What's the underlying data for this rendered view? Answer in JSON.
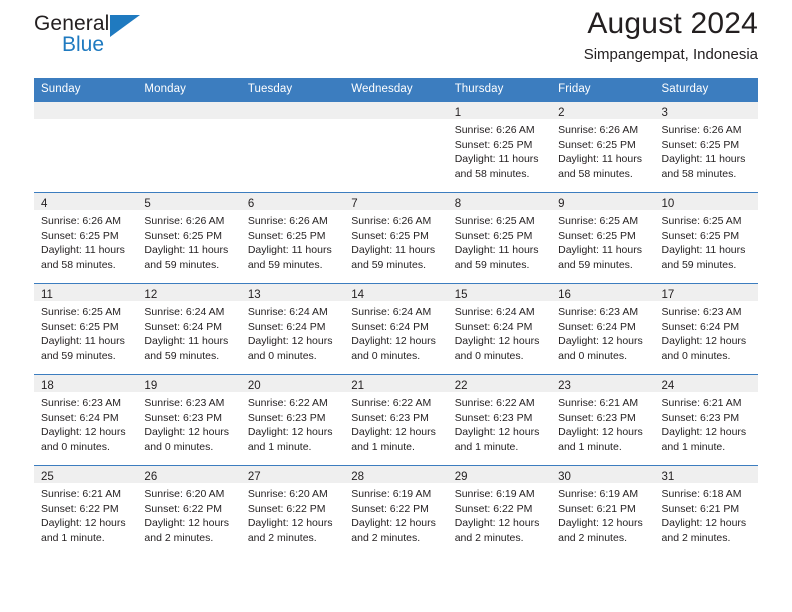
{
  "logo": {
    "word_top": "General",
    "word_bottom": "Blue",
    "triangle_color": "#1f7ac0"
  },
  "header": {
    "title": "August 2024",
    "subtitle": "Simpangempat, Indonesia"
  },
  "theme": {
    "header_blue": "#3c7dbf",
    "daystrip_gray": "#efefef",
    "text": "#231f20"
  },
  "weekday_headers": [
    "Sunday",
    "Monday",
    "Tuesday",
    "Wednesday",
    "Thursday",
    "Friday",
    "Saturday"
  ],
  "labels": {
    "sunrise_prefix": "Sunrise:",
    "sunset_prefix": "Sunset:",
    "daylight_prefix": "Daylight:"
  },
  "weeks": [
    [
      {
        "empty": true
      },
      {
        "empty": true
      },
      {
        "empty": true
      },
      {
        "empty": true
      },
      {
        "day": "1",
        "sunrise": "Sunrise: 6:26 AM",
        "sunset": "Sunset: 6:25 PM",
        "daylight_l1": "Daylight: 11 hours",
        "daylight_l2": "and 58 minutes."
      },
      {
        "day": "2",
        "sunrise": "Sunrise: 6:26 AM",
        "sunset": "Sunset: 6:25 PM",
        "daylight_l1": "Daylight: 11 hours",
        "daylight_l2": "and 58 minutes."
      },
      {
        "day": "3",
        "sunrise": "Sunrise: 6:26 AM",
        "sunset": "Sunset: 6:25 PM",
        "daylight_l1": "Daylight: 11 hours",
        "daylight_l2": "and 58 minutes."
      }
    ],
    [
      {
        "day": "4",
        "sunrise": "Sunrise: 6:26 AM",
        "sunset": "Sunset: 6:25 PM",
        "daylight_l1": "Daylight: 11 hours",
        "daylight_l2": "and 58 minutes."
      },
      {
        "day": "5",
        "sunrise": "Sunrise: 6:26 AM",
        "sunset": "Sunset: 6:25 PM",
        "daylight_l1": "Daylight: 11 hours",
        "daylight_l2": "and 59 minutes."
      },
      {
        "day": "6",
        "sunrise": "Sunrise: 6:26 AM",
        "sunset": "Sunset: 6:25 PM",
        "daylight_l1": "Daylight: 11 hours",
        "daylight_l2": "and 59 minutes."
      },
      {
        "day": "7",
        "sunrise": "Sunrise: 6:26 AM",
        "sunset": "Sunset: 6:25 PM",
        "daylight_l1": "Daylight: 11 hours",
        "daylight_l2": "and 59 minutes."
      },
      {
        "day": "8",
        "sunrise": "Sunrise: 6:25 AM",
        "sunset": "Sunset: 6:25 PM",
        "daylight_l1": "Daylight: 11 hours",
        "daylight_l2": "and 59 minutes."
      },
      {
        "day": "9",
        "sunrise": "Sunrise: 6:25 AM",
        "sunset": "Sunset: 6:25 PM",
        "daylight_l1": "Daylight: 11 hours",
        "daylight_l2": "and 59 minutes."
      },
      {
        "day": "10",
        "sunrise": "Sunrise: 6:25 AM",
        "sunset": "Sunset: 6:25 PM",
        "daylight_l1": "Daylight: 11 hours",
        "daylight_l2": "and 59 minutes."
      }
    ],
    [
      {
        "day": "11",
        "sunrise": "Sunrise: 6:25 AM",
        "sunset": "Sunset: 6:25 PM",
        "daylight_l1": "Daylight: 11 hours",
        "daylight_l2": "and 59 minutes."
      },
      {
        "day": "12",
        "sunrise": "Sunrise: 6:24 AM",
        "sunset": "Sunset: 6:24 PM",
        "daylight_l1": "Daylight: 11 hours",
        "daylight_l2": "and 59 minutes."
      },
      {
        "day": "13",
        "sunrise": "Sunrise: 6:24 AM",
        "sunset": "Sunset: 6:24 PM",
        "daylight_l1": "Daylight: 12 hours",
        "daylight_l2": "and 0 minutes."
      },
      {
        "day": "14",
        "sunrise": "Sunrise: 6:24 AM",
        "sunset": "Sunset: 6:24 PM",
        "daylight_l1": "Daylight: 12 hours",
        "daylight_l2": "and 0 minutes."
      },
      {
        "day": "15",
        "sunrise": "Sunrise: 6:24 AM",
        "sunset": "Sunset: 6:24 PM",
        "daylight_l1": "Daylight: 12 hours",
        "daylight_l2": "and 0 minutes."
      },
      {
        "day": "16",
        "sunrise": "Sunrise: 6:23 AM",
        "sunset": "Sunset: 6:24 PM",
        "daylight_l1": "Daylight: 12 hours",
        "daylight_l2": "and 0 minutes."
      },
      {
        "day": "17",
        "sunrise": "Sunrise: 6:23 AM",
        "sunset": "Sunset: 6:24 PM",
        "daylight_l1": "Daylight: 12 hours",
        "daylight_l2": "and 0 minutes."
      }
    ],
    [
      {
        "day": "18",
        "sunrise": "Sunrise: 6:23 AM",
        "sunset": "Sunset: 6:24 PM",
        "daylight_l1": "Daylight: 12 hours",
        "daylight_l2": "and 0 minutes."
      },
      {
        "day": "19",
        "sunrise": "Sunrise: 6:23 AM",
        "sunset": "Sunset: 6:23 PM",
        "daylight_l1": "Daylight: 12 hours",
        "daylight_l2": "and 0 minutes."
      },
      {
        "day": "20",
        "sunrise": "Sunrise: 6:22 AM",
        "sunset": "Sunset: 6:23 PM",
        "daylight_l1": "Daylight: 12 hours",
        "daylight_l2": "and 1 minute."
      },
      {
        "day": "21",
        "sunrise": "Sunrise: 6:22 AM",
        "sunset": "Sunset: 6:23 PM",
        "daylight_l1": "Daylight: 12 hours",
        "daylight_l2": "and 1 minute."
      },
      {
        "day": "22",
        "sunrise": "Sunrise: 6:22 AM",
        "sunset": "Sunset: 6:23 PM",
        "daylight_l1": "Daylight: 12 hours",
        "daylight_l2": "and 1 minute."
      },
      {
        "day": "23",
        "sunrise": "Sunrise: 6:21 AM",
        "sunset": "Sunset: 6:23 PM",
        "daylight_l1": "Daylight: 12 hours",
        "daylight_l2": "and 1 minute."
      },
      {
        "day": "24",
        "sunrise": "Sunrise: 6:21 AM",
        "sunset": "Sunset: 6:23 PM",
        "daylight_l1": "Daylight: 12 hours",
        "daylight_l2": "and 1 minute."
      }
    ],
    [
      {
        "day": "25",
        "sunrise": "Sunrise: 6:21 AM",
        "sunset": "Sunset: 6:22 PM",
        "daylight_l1": "Daylight: 12 hours",
        "daylight_l2": "and 1 minute."
      },
      {
        "day": "26",
        "sunrise": "Sunrise: 6:20 AM",
        "sunset": "Sunset: 6:22 PM",
        "daylight_l1": "Daylight: 12 hours",
        "daylight_l2": "and 2 minutes."
      },
      {
        "day": "27",
        "sunrise": "Sunrise: 6:20 AM",
        "sunset": "Sunset: 6:22 PM",
        "daylight_l1": "Daylight: 12 hours",
        "daylight_l2": "and 2 minutes."
      },
      {
        "day": "28",
        "sunrise": "Sunrise: 6:19 AM",
        "sunset": "Sunset: 6:22 PM",
        "daylight_l1": "Daylight: 12 hours",
        "daylight_l2": "and 2 minutes."
      },
      {
        "day": "29",
        "sunrise": "Sunrise: 6:19 AM",
        "sunset": "Sunset: 6:22 PM",
        "daylight_l1": "Daylight: 12 hours",
        "daylight_l2": "and 2 minutes."
      },
      {
        "day": "30",
        "sunrise": "Sunrise: 6:19 AM",
        "sunset": "Sunset: 6:21 PM",
        "daylight_l1": "Daylight: 12 hours",
        "daylight_l2": "and 2 minutes."
      },
      {
        "day": "31",
        "sunrise": "Sunrise: 6:18 AM",
        "sunset": "Sunset: 6:21 PM",
        "daylight_l1": "Daylight: 12 hours",
        "daylight_l2": "and 2 minutes."
      }
    ]
  ]
}
